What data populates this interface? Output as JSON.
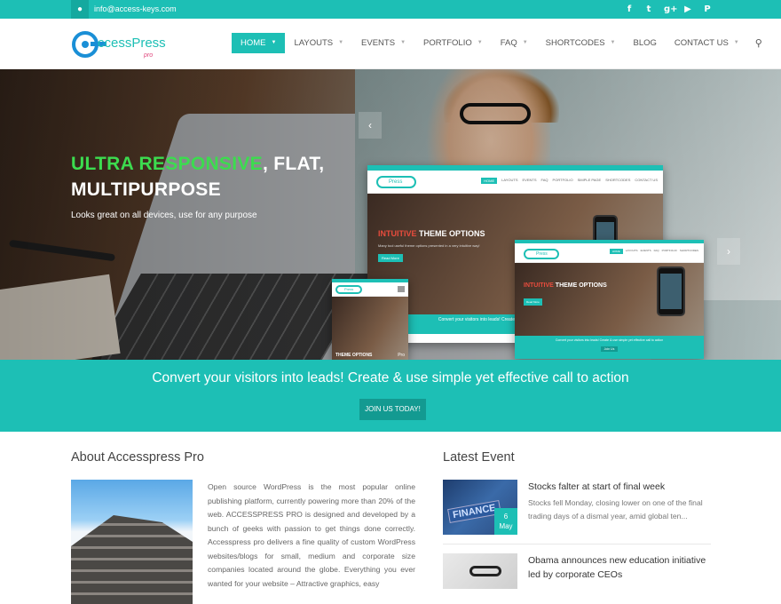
{
  "topbar": {
    "email": "info@access-keys.com",
    "social_icons": [
      "facebook-icon",
      "twitter-icon",
      "google-plus-icon",
      "youtube-icon",
      "pinterest-icon"
    ],
    "social_glyphs": [
      "f",
      "t",
      "g+",
      "▶",
      "P"
    ]
  },
  "brand": {
    "logo_text": "ccessPress",
    "logo_sub": "pro",
    "accent": "#1dbfb5",
    "highlight": "#3cdc4f"
  },
  "nav": {
    "items": [
      {
        "label": "HOME",
        "active": true,
        "dropdown": true
      },
      {
        "label": "LAYOUTS",
        "active": false,
        "dropdown": true
      },
      {
        "label": "EVENTS",
        "active": false,
        "dropdown": true
      },
      {
        "label": "PORTFOLIO",
        "active": false,
        "dropdown": true
      },
      {
        "label": "FAQ",
        "active": false,
        "dropdown": true
      },
      {
        "label": "SHORTCODES",
        "active": false,
        "dropdown": true
      },
      {
        "label": "BLOG",
        "active": false,
        "dropdown": false
      },
      {
        "label": "CONTACT US",
        "active": false,
        "dropdown": true
      }
    ],
    "search_icon": "search-icon"
  },
  "hero": {
    "title_highlight": "ULTRA RESPONSIVE",
    "title_rest": ", FLAT,",
    "title_line2": "MULTIPURPOSE",
    "subtitle": "Looks great on all devices, use for any purpose",
    "prev_glyph": "‹",
    "next_glyph": "›",
    "mock": {
      "email": "info@accesskeys.com",
      "nav": [
        "HOME",
        "LAYOUTS",
        "EVENTS",
        "FAQ",
        "PORTFOLIO",
        "SIMPLE PAGE",
        "SHORTCODES",
        "CONTACT US"
      ],
      "headline": "THEME OPTIONS",
      "headline_accent": "INTUITIVE",
      "tagline": "Many tool useful theme options presented in a very intuitive way!",
      "button": "Read More",
      "cta": "Convert your visitors into leads! Create & use simple yet effective call to action",
      "cta_btn": "Join Us",
      "small_label": "Pro"
    },
    "slides": 3,
    "active_slide": 1
  },
  "cta": {
    "text": "Convert your visitors into leads! Create & use simple yet effective call to action",
    "button": "JOIN US TODAY!"
  },
  "about": {
    "title": "About Accesspress Pro",
    "text": "Open source WordPress is the most popular online publishing platform, currently powering more than 20% of the web. ACCESSPRESS PRO is designed and developed by a bunch of geeks with passion to get things done correctly. Accesspress pro delivers a fine quality of custom WordPress websites/blogs for small, medium and corporate size companies located around the globe. Everything you ever wanted for your website – Attractive graphics, easy"
  },
  "latest": {
    "title": "Latest Event",
    "events": [
      {
        "title": "Stocks falter at start of final week",
        "desc": "Stocks fell Monday, closing lower on one of the final trading days of a dismal year, amid global ten...",
        "day": "6",
        "month": "May",
        "image_word": "FINANCE"
      },
      {
        "title": "Obama announces new education initiative led by corporate CEOs",
        "desc": ""
      }
    ]
  }
}
